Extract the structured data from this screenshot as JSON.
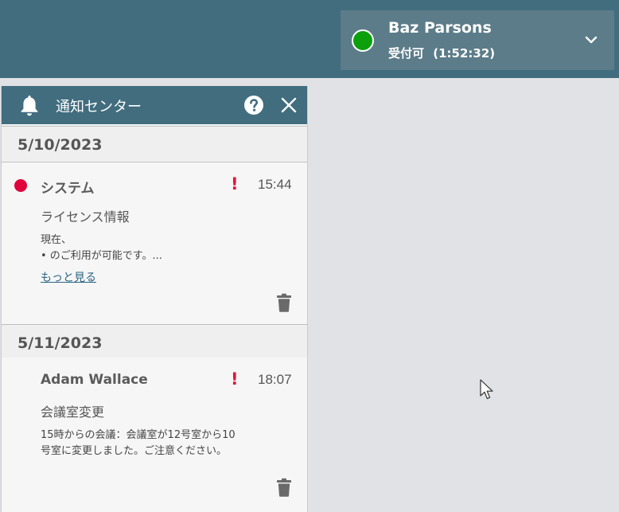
{
  "user": {
    "name": "Baz Parsons",
    "status_label": "受付可",
    "status_timer": "(1:52:32)",
    "status_color": "#0ca00c"
  },
  "panel": {
    "title": "通知センター"
  },
  "groups": [
    {
      "date": "5/10/2023",
      "notifications": [
        {
          "sender": "システム",
          "priority_mark": "!",
          "time": "15:44",
          "subject": "ライセンス情報",
          "body_lines": [
            "現在、",
            "• のご利用が可能です。..."
          ],
          "more_link": "もっと見る",
          "unread_dot_color": "#e0003c"
        }
      ]
    },
    {
      "date": "5/11/2023",
      "notifications": [
        {
          "sender": "Adam Wallace",
          "priority_mark": "!",
          "time": "18:07",
          "subject": "会議室変更",
          "body_lines": [
            "15時からの会議：会議室が12号室から10",
            "号室に変更しました。ご注意ください。"
          ]
        }
      ]
    }
  ],
  "colors": {
    "header_bg": "#416d7f",
    "accent_alert": "#e0163c",
    "link": "#2c6584"
  }
}
